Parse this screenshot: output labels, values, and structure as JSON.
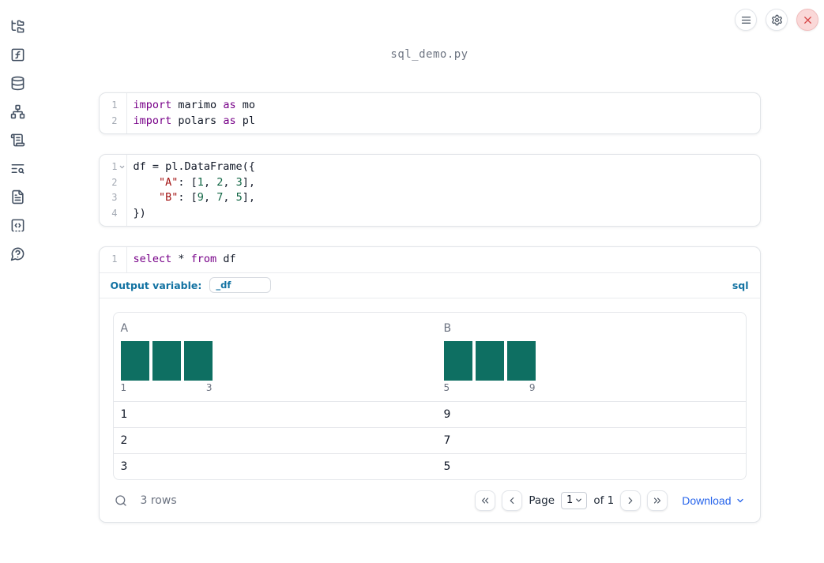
{
  "app": {
    "filename": "sql_demo.py"
  },
  "topbar": {
    "buttons": [
      {
        "name": "notebook-menu",
        "icon": "hamburger-menu-icon"
      },
      {
        "name": "settings",
        "icon": "gear-icon"
      },
      {
        "name": "shutdown",
        "icon": "close-x-icon"
      }
    ]
  },
  "sidebar": {
    "items": [
      {
        "icon": "folder-tree-icon",
        "name": "file-explorer"
      },
      {
        "icon": "function-square-icon",
        "name": "variables"
      },
      {
        "icon": "database-icon",
        "name": "data-sources"
      },
      {
        "icon": "network-graph-icon",
        "name": "dependency-graph"
      },
      {
        "icon": "scroll-text-icon",
        "name": "logs"
      },
      {
        "icon": "text-search-icon",
        "name": "outline-search"
      },
      {
        "icon": "file-text-icon",
        "name": "documentation"
      },
      {
        "icon": "code-snippet-icon",
        "name": "snippets"
      },
      {
        "icon": "help-bubble-icon",
        "name": "help"
      }
    ]
  },
  "cells": [
    {
      "lines": [
        {
          "n": "1",
          "tokens": [
            {
              "t": "kw",
              "v": "import"
            },
            {
              "t": "pl",
              "v": " marimo "
            },
            {
              "t": "kw",
              "v": "as"
            },
            {
              "t": "pl",
              "v": " mo"
            }
          ]
        },
        {
          "n": "2",
          "tokens": [
            {
              "t": "kw",
              "v": "import"
            },
            {
              "t": "pl",
              "v": " polars "
            },
            {
              "t": "kw",
              "v": "as"
            },
            {
              "t": "pl",
              "v": " pl"
            }
          ]
        }
      ]
    },
    {
      "lines": [
        {
          "n": "1",
          "fold": true,
          "tokens": [
            {
              "t": "pl",
              "v": "df = pl.DataFrame({"
            }
          ]
        },
        {
          "n": "2",
          "tokens": [
            {
              "t": "pl",
              "v": "    "
            },
            {
              "t": "str",
              "v": "\"A\""
            },
            {
              "t": "pl",
              "v": ": ["
            },
            {
              "t": "num",
              "v": "1"
            },
            {
              "t": "pl",
              "v": ", "
            },
            {
              "t": "num",
              "v": "2"
            },
            {
              "t": "pl",
              "v": ", "
            },
            {
              "t": "num",
              "v": "3"
            },
            {
              "t": "pl",
              "v": "],"
            }
          ]
        },
        {
          "n": "3",
          "tokens": [
            {
              "t": "pl",
              "v": "    "
            },
            {
              "t": "str",
              "v": "\"B\""
            },
            {
              "t": "pl",
              "v": ": ["
            },
            {
              "t": "num",
              "v": "9"
            },
            {
              "t": "pl",
              "v": ", "
            },
            {
              "t": "num",
              "v": "7"
            },
            {
              "t": "pl",
              "v": ", "
            },
            {
              "t": "num",
              "v": "5"
            },
            {
              "t": "pl",
              "v": "],"
            }
          ]
        },
        {
          "n": "4",
          "tokens": [
            {
              "t": "pl",
              "v": "})"
            }
          ]
        }
      ]
    },
    {
      "lines": [
        {
          "n": "1",
          "tokens": [
            {
              "t": "kw",
              "v": "select"
            },
            {
              "t": "pl",
              "v": " * "
            },
            {
              "t": "kw",
              "v": "from"
            },
            {
              "t": "pl",
              "v": " df"
            }
          ]
        }
      ]
    }
  ],
  "sql_cell": {
    "output_variable_label": "Output variable:",
    "output_variable_value": "_df",
    "language_badge": "sql"
  },
  "table": {
    "columns": [
      {
        "label": "A",
        "histogram": {
          "bar_count": 3,
          "bar_heights": [
            1,
            1,
            1
          ],
          "axis_labels": [
            "1",
            "3"
          ]
        }
      },
      {
        "label": "B",
        "histogram": {
          "bar_count": 3,
          "bar_heights": [
            1,
            1,
            1
          ],
          "axis_labels": [
            "5",
            "9"
          ]
        }
      }
    ],
    "rows": [
      [
        "1",
        "9"
      ],
      [
        "2",
        "7"
      ],
      [
        "3",
        "5"
      ]
    ],
    "footer": {
      "row_count": "3 rows",
      "page_label": "Page",
      "page_value": "1",
      "of_label": "of 1",
      "download_label": "Download"
    }
  },
  "colors": {
    "accent_blue": "#1272a2",
    "download_blue": "#2563eb",
    "bar_teal": "#0e6f62",
    "kw": "#770088",
    "str": "#a31515",
    "num": "#116644"
  }
}
